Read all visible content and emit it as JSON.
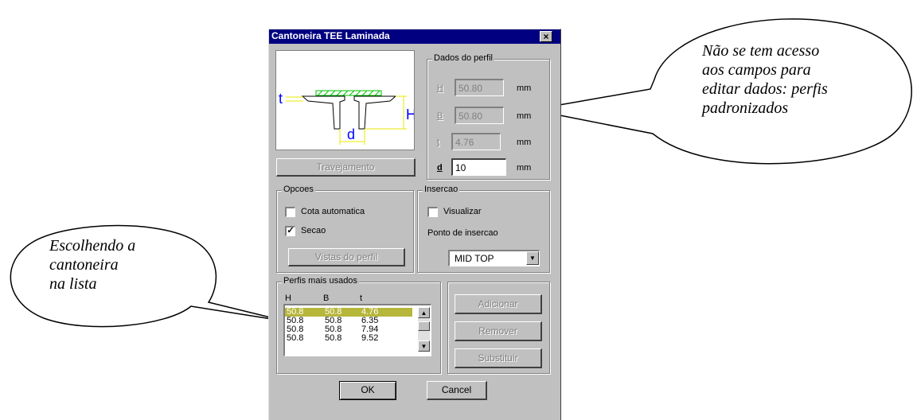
{
  "dialog": {
    "title": "Cantoneira TEE Laminada",
    "close_symbol": "×",
    "travejamento_label": "Travejamento",
    "dados_perfil": {
      "legend": "Dados do perfil",
      "fields": [
        {
          "label": "H",
          "value": "50.80",
          "unit": "mm"
        },
        {
          "label": "B",
          "value": "50.80",
          "unit": "mm"
        },
        {
          "label": "t",
          "value": "4.76",
          "unit": "mm"
        },
        {
          "label": "d",
          "value": "10",
          "unit": "mm"
        }
      ]
    },
    "opcoes": {
      "legend": "Opcoes",
      "cota_automatica_label": "Cota automatica",
      "cota_automatica_checked": false,
      "secao_label": "Secao",
      "secao_checked": true,
      "vistas_label": "Vistas do perfil"
    },
    "insercao": {
      "legend": "Insercao",
      "visualizar_label": "Visualizar",
      "visualizar_checked": false,
      "ponto_label": "Ponto de insercao",
      "ponto_value": "MID TOP"
    },
    "perfis": {
      "legend": "Perfis mais usados",
      "headers": [
        "H",
        "B",
        "t"
      ],
      "rows": [
        [
          "50.8",
          "50.8",
          "4.76"
        ],
        [
          "50.8",
          "50.8",
          "6.35"
        ],
        [
          "50.8",
          "50.8",
          "7.94"
        ],
        [
          "50.8",
          "50.8",
          "9.52"
        ]
      ],
      "selected_index": 0
    },
    "actions": {
      "adicionar": "Adicionar",
      "remover": "Remover",
      "substituir": "Substituir"
    },
    "ok_label": "OK",
    "cancel_label": "Cancel",
    "diagram_labels": {
      "t": "t",
      "d": "d",
      "H": "H"
    }
  },
  "callouts": {
    "right_lines": [
      "Não se tem acesso",
      "aos campos para",
      "editar dados: perfis",
      "padronizados"
    ],
    "left_lines": [
      "Escolhendo a",
      "cantoneira",
      "na lista"
    ]
  },
  "colors": {
    "title_bar": "#000080",
    "dialog_bg": "#c0c0c0",
    "selection": "#b6b63a",
    "diagram_blue": "#0000ff",
    "diagram_yellow": "#e8e800",
    "diagram_green": "#00c000"
  }
}
